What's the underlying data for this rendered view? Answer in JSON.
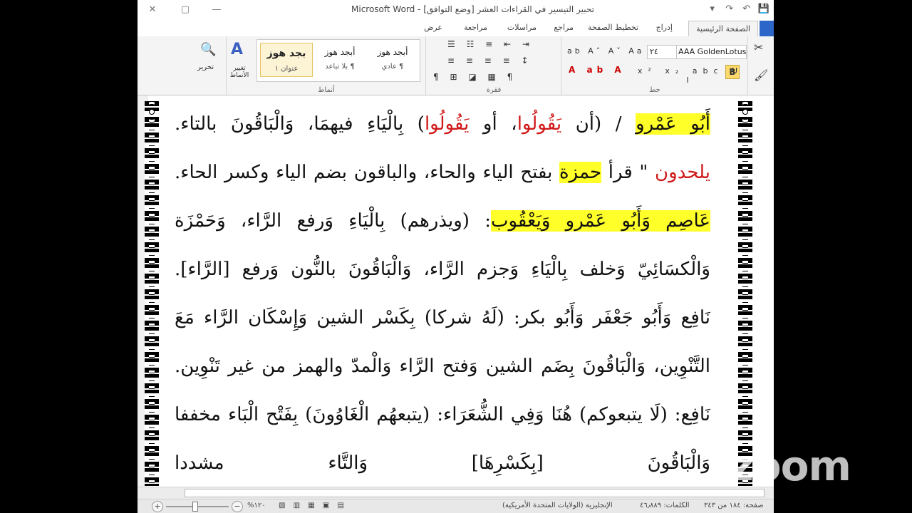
{
  "window": {
    "title": "تحبير التيسير في القراءات العشر [وضع التوافق] - Microsoft Word",
    "controls": {
      "close": "✕",
      "restore": "▢",
      "minimize": "—"
    }
  },
  "qat": {
    "save": "💾",
    "undo": "↶",
    "redo": "↷",
    "customize": "▾"
  },
  "tabs": [
    {
      "label": "الصفحة الرئيسية"
    },
    {
      "label": "إدراج"
    },
    {
      "label": "تخطيط الصفحة"
    },
    {
      "label": "مراجع"
    },
    {
      "label": "مراسلات"
    },
    {
      "label": "مراجعة"
    },
    {
      "label": "عرض"
    }
  ],
  "ribbon": {
    "font": {
      "name": "AAA GoldenLotus",
      "size": "٢٤",
      "group_label": "خط"
    },
    "paragraph": {
      "group_label": "فقرة"
    },
    "styles": {
      "group_label": "أنماط",
      "items": [
        {
          "sample": "أبجد هوز",
          "name": "¶ عادي"
        },
        {
          "sample": "أبجد هوز",
          "name": "¶ بلا تباعد"
        },
        {
          "sample": "بجد هوز",
          "name": "عنوان ١"
        }
      ],
      "change_styles": "تغيير الأنماط"
    },
    "editing": {
      "label": "تحرير"
    }
  },
  "document": {
    "lines": [
      [
        {
          "t": "أَبُو عَمْرو",
          "hl": true
        },
        {
          "t": " / (أن "
        },
        {
          "t": "يَقُولُوا",
          "red": true
        },
        {
          "t": "، أو "
        },
        {
          "t": "يَقُولُوا",
          "red": true
        },
        {
          "t": ") بِالْيَاءِ فيهمَا، وَالْبَاقُونَ بالتاء."
        }
      ],
      [
        {
          "t": "يلحدون",
          "red": true
        },
        {
          "t": " \" قرأ "
        },
        {
          "t": "حمزة",
          "hl": true
        },
        {
          "t": " بفتح الياء والحاء، والباقون بضم الياء وكسر الحاء."
        }
      ],
      [
        {
          "t": "عَاصِم وَأَبُو عَمْرو وَيَعْقُوب",
          "hl": true
        },
        {
          "t": ": (ويذرهم) بِالْيَاءِ وَرفع الرَّاء، وَحَمْزَة"
        }
      ],
      [
        {
          "t": "وَالْكسَائِيّ وَخلف بِالْيَاءِ وَجزم الرَّاء، وَالْبَاقُونَ بالنُّون وَرفع [الرَّاء]."
        }
      ],
      [
        {
          "t": "نَافِع وَأَبُو جَعْفَر وَأَبُو بكر: (لَهُ شركا) بِكَسْر الشين وَإِسْكَان الرَّاء مَعَ"
        }
      ],
      [
        {
          "t": "التَّنْوِين، وَالْبَاقُونَ بِضَم الشين وَفتح الرَّاء وَالْمدّ والهمز من غير تَنْوِين."
        }
      ],
      [
        {
          "t": "نَافِع: (لَا يتبعوكم) هُنَا وَفِي الشُّعَرَاء: (يتبعهُم الْغَاوُونَ) بِفَتْح الْبَاء مخففا"
        }
      ],
      [
        {
          "t": "وَالْبَاقُونَ [بِكَسْرِهَا] وَالتَّاء مشددا"
        }
      ]
    ]
  },
  "statusbar": {
    "page": "صفحة: ١٨٤ من ٣٤٣",
    "words": "الكلمات: ٤٦٫٨٨٩",
    "language": "الإنجليزية (الولايات المتحدة الأمريكية)",
    "zoom": "١٢٠%"
  },
  "watermark": "zoom"
}
